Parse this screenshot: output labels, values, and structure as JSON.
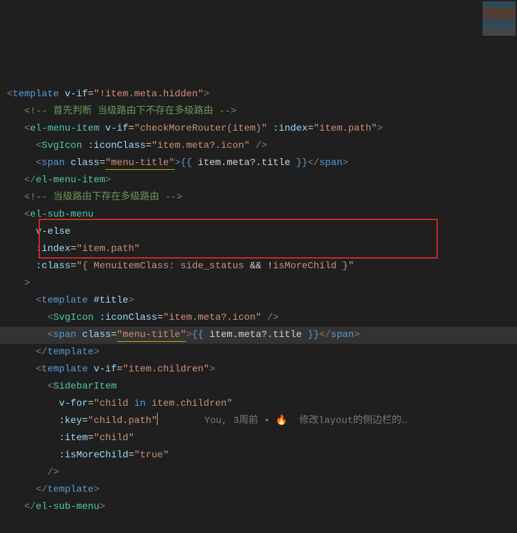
{
  "comments": {
    "c1": "<!-- 首先判断 当级路由下不存在多级路由 -->",
    "c2": "<!-- 当级路由下存在多级路由 -->"
  },
  "tags": {
    "template": "template",
    "elMenuItem": "el-menu-item",
    "SvgIcon": "SvgIcon",
    "span": "span",
    "elSubMenu": "el-sub-menu",
    "SidebarItem": "SidebarItem"
  },
  "attrs": {
    "vif": "v-if",
    "vif_val1": "\"!item.meta.hidden\"",
    "vif_val2": "\"checkMoreRouter(item)\"",
    "index": ":index",
    "index_val": "\"item.path\"",
    "iconClass": ":iconClass",
    "iconClass_val": "\"item.meta?.icon\"",
    "class": "class",
    "dynClass": ":class",
    "menuTitle": "\"menu-title\"",
    "dynClass_val": "\"{ MenuitemClass: side_status && !isMoreChild }\"",
    "and": "&&",
    "not": "!",
    "velse": "v-else",
    "slotTitle": "#title",
    "vif_children": "\"item.children\"",
    "vfor": "v-for",
    "vfor_val_pre": "\"child ",
    "vfor_in": "in",
    "vfor_val_post": " item.children\"",
    "key": ":key",
    "key_val": "\"child.path\"",
    "item": ":item",
    "item_val": "\"child\"",
    "isMoreChild": ":isMoreChild",
    "true_val": "\"true\""
  },
  "interp": {
    "open": "{{",
    "close": "}}",
    "expr": " item.meta?.title "
  },
  "blame": {
    "author": "You, ",
    "time": "3周前",
    "msg": "修改layout的侧边栏的…"
  },
  "chart_data": null
}
